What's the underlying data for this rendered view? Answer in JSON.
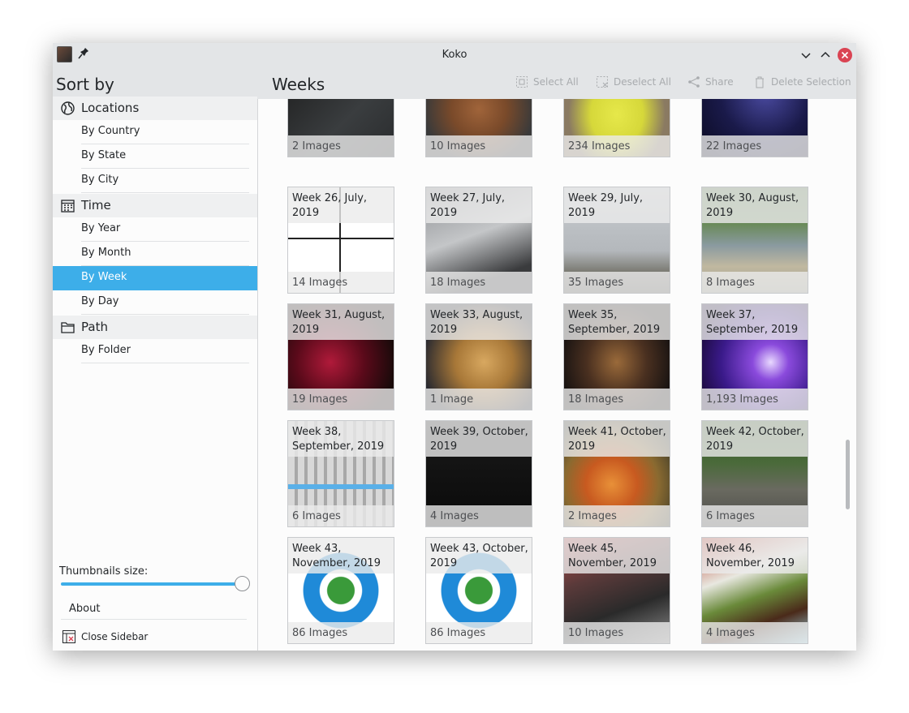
{
  "window": {
    "title": "Koko"
  },
  "header": {
    "sortby": "Sort by",
    "page_title": "Weeks",
    "actions": {
      "select_all": "Select All",
      "deselect_all": "Deselect All",
      "share": "Share",
      "delete_selection": "Delete Selection"
    }
  },
  "sidebar": {
    "sections": [
      {
        "label": "Locations",
        "icon": "globe-icon",
        "items": [
          "By Country",
          "By State",
          "By City"
        ]
      },
      {
        "label": "Time",
        "icon": "calendar-icon",
        "items": [
          "By Year",
          "By Month",
          "By Week",
          "By Day"
        ]
      },
      {
        "label": "Path",
        "icon": "folder-icon",
        "items": [
          "By Folder"
        ]
      }
    ],
    "active_item": "By Week",
    "thumbnails_label": "Thumbnails size:",
    "thumbnail_size_level": 1.0,
    "about": "About",
    "close_sidebar": "Close Sidebar"
  },
  "colors": {
    "accent": "#3daee9",
    "close": "#da4453"
  },
  "tiles": [
    {
      "title": "",
      "count": "2 Images"
    },
    {
      "title": "",
      "count": "10 Images"
    },
    {
      "title": "",
      "count": "234 Images"
    },
    {
      "title": "",
      "count": "22 Images"
    },
    {
      "title": "Week 26, July, 2019",
      "count": "14 Images"
    },
    {
      "title": "Week 27, July, 2019",
      "count": "18 Images"
    },
    {
      "title": "Week 29, July, 2019",
      "count": "35 Images"
    },
    {
      "title": "Week 30, August, 2019",
      "count": "8 Images"
    },
    {
      "title": "Week 31, August, 2019",
      "count": "19 Images"
    },
    {
      "title": "Week 33, August, 2019",
      "count": "1 Image"
    },
    {
      "title": "Week 35, September, 2019",
      "count": "18 Images"
    },
    {
      "title": "Week 37, September, 2019",
      "count": "1,193 Images"
    },
    {
      "title": "Week 38, September, 2019",
      "count": "6 Images"
    },
    {
      "title": "Week 39, October, 2019",
      "count": "4 Images"
    },
    {
      "title": "Week 41, October, 2019",
      "count": "2 Images"
    },
    {
      "title": "Week 42, October, 2019",
      "count": "6 Images"
    },
    {
      "title": "Week 43, November, 2019",
      "count": "86 Images"
    },
    {
      "title": "Week 43, October, 2019",
      "count": "86 Images"
    },
    {
      "title": "Week 45, November, 2019",
      "count": "10 Images"
    },
    {
      "title": "Week 46, November, 2019",
      "count": "4 Images"
    }
  ]
}
